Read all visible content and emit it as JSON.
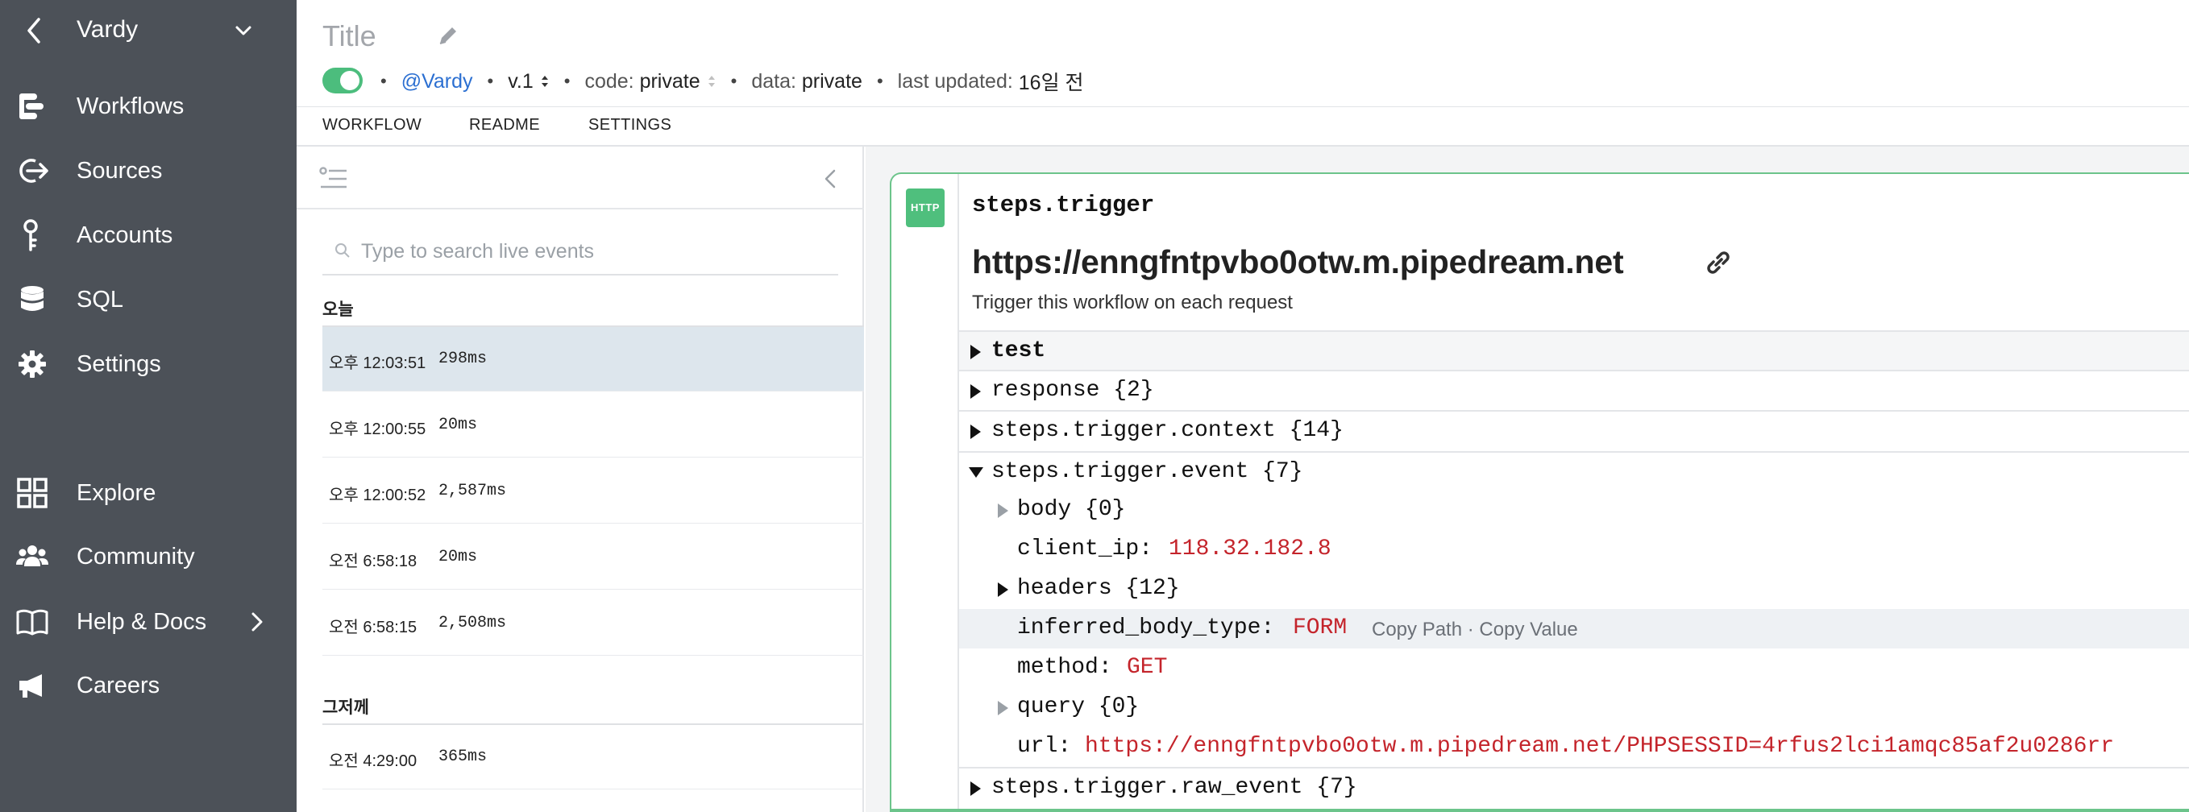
{
  "sidebar": {
    "title": "Vardy",
    "items": [
      {
        "label": "Workflows",
        "icon": "workflows-icon"
      },
      {
        "label": "Sources",
        "icon": "sources-icon"
      },
      {
        "label": "Accounts",
        "icon": "key-icon"
      },
      {
        "label": "SQL",
        "icon": "database-icon"
      },
      {
        "label": "Settings",
        "icon": "gear-icon"
      },
      {
        "label": "Explore",
        "icon": "grid-icon"
      },
      {
        "label": "Community",
        "icon": "people-icon"
      },
      {
        "label": "Help & Docs",
        "icon": "book-icon"
      },
      {
        "label": "Careers",
        "icon": "megaphone-icon"
      }
    ]
  },
  "header": {
    "title": "Title",
    "user": "@Vardy",
    "version": "v.1",
    "code_label": "code:",
    "code_value": "private",
    "data_label": "data:",
    "data_value": "private",
    "updated_label": "last updated:",
    "updated_value": "16일 전",
    "tabs": [
      "WORKFLOW",
      "README",
      "SETTINGS"
    ],
    "active_toggle": true,
    "accent": "#4cbd7d"
  },
  "events": {
    "search_placeholder": "Type to search live events",
    "groups": [
      {
        "label": "오늘",
        "rows": [
          {
            "time": "오후 12:03:51",
            "duration": "298ms",
            "selected": true
          },
          {
            "time": "오후 12:00:55",
            "duration": "20ms"
          },
          {
            "time": "오후 12:00:52",
            "duration": "2,587ms"
          },
          {
            "time": "오전 6:58:18",
            "duration": "20ms"
          },
          {
            "time": "오전 6:58:15",
            "duration": "2,508ms"
          }
        ]
      },
      {
        "label": "그저께",
        "rows": [
          {
            "time": "오전 4:29:00",
            "duration": "365ms"
          }
        ]
      }
    ]
  },
  "trigger": {
    "badge": "HTTP",
    "step_name": "steps.trigger",
    "endpoint": "https://enngfntpvbo0otw.m.pipedream.net",
    "description": "Trigger this workflow on each request",
    "tree": {
      "test": "test",
      "response": "response {2}",
      "context": "steps.trigger.context {14}",
      "event": "steps.trigger.event {7}",
      "body": "body {0}",
      "client_ip_key": "client_ip:",
      "client_ip_val": "118.32.182.8",
      "headers": "headers {12}",
      "inferred_key": "inferred_body_type:",
      "inferred_val": "FORM",
      "copy_path": "Copy Path",
      "copy_sep": "·",
      "copy_value": "Copy Value",
      "method_key": "method:",
      "method_val": "GET",
      "query": "query {0}",
      "url_key": "url:",
      "url_val": "https://enngfntpvbo0otw.m.pipedream.net/PHPSESSID=4rfus2lci1amqc85af2u0286rr",
      "raw_event": "steps.trigger.raw_event {7}"
    },
    "value_color": "#c4242b"
  }
}
